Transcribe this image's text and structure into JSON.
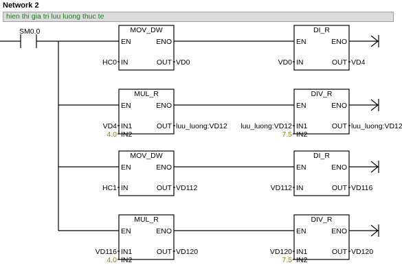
{
  "network": {
    "title": "Network 2",
    "comment": "hien thi gia tri luu luong thuc te"
  },
  "contact": {
    "label": "SM0.0"
  },
  "blocks": [
    {
      "title": "MOV_DW",
      "en": "EN",
      "eno": "ENO",
      "inputs": [
        [
          "IN",
          "HC0"
        ]
      ],
      "out": [
        "OUT",
        "VD0"
      ]
    },
    {
      "title": "DI_R",
      "en": "EN",
      "eno": "ENO",
      "inputs": [
        [
          "IN",
          "VD0"
        ]
      ],
      "out": [
        "OUT",
        "VD4"
      ]
    },
    {
      "title": "MUL_R",
      "en": "EN",
      "eno": "ENO",
      "inputs": [
        [
          "IN1",
          "VD4"
        ],
        [
          "IN2",
          "4.0"
        ]
      ],
      "out": [
        "OUT",
        "luu_luong:VD12"
      ]
    },
    {
      "title": "DIV_R",
      "en": "EN",
      "eno": "ENO",
      "inputs": [
        [
          "IN1",
          "luu_luong:VD12"
        ],
        [
          "IN2",
          "7.5"
        ]
      ],
      "out": [
        "OUT",
        "luu_luong:VD12"
      ]
    },
    {
      "title": "MOV_DW",
      "en": "EN",
      "eno": "ENO",
      "inputs": [
        [
          "IN",
          "HC1"
        ]
      ],
      "out": [
        "OUT",
        "VD112"
      ]
    },
    {
      "title": "DI_R",
      "en": "EN",
      "eno": "ENO",
      "inputs": [
        [
          "IN",
          "VD112"
        ]
      ],
      "out": [
        "OUT",
        "VD116"
      ]
    },
    {
      "title": "MUL_R",
      "en": "EN",
      "eno": "ENO",
      "inputs": [
        [
          "IN1",
          "VD116"
        ],
        [
          "IN2",
          "4.0"
        ]
      ],
      "out": [
        "OUT",
        "VD120"
      ]
    },
    {
      "title": "DIV_R",
      "en": "EN",
      "eno": "ENO",
      "inputs": [
        [
          "IN1",
          "VD120"
        ],
        [
          "IN2",
          "7.5"
        ]
      ],
      "out": [
        "OUT",
        "VD120"
      ]
    }
  ]
}
